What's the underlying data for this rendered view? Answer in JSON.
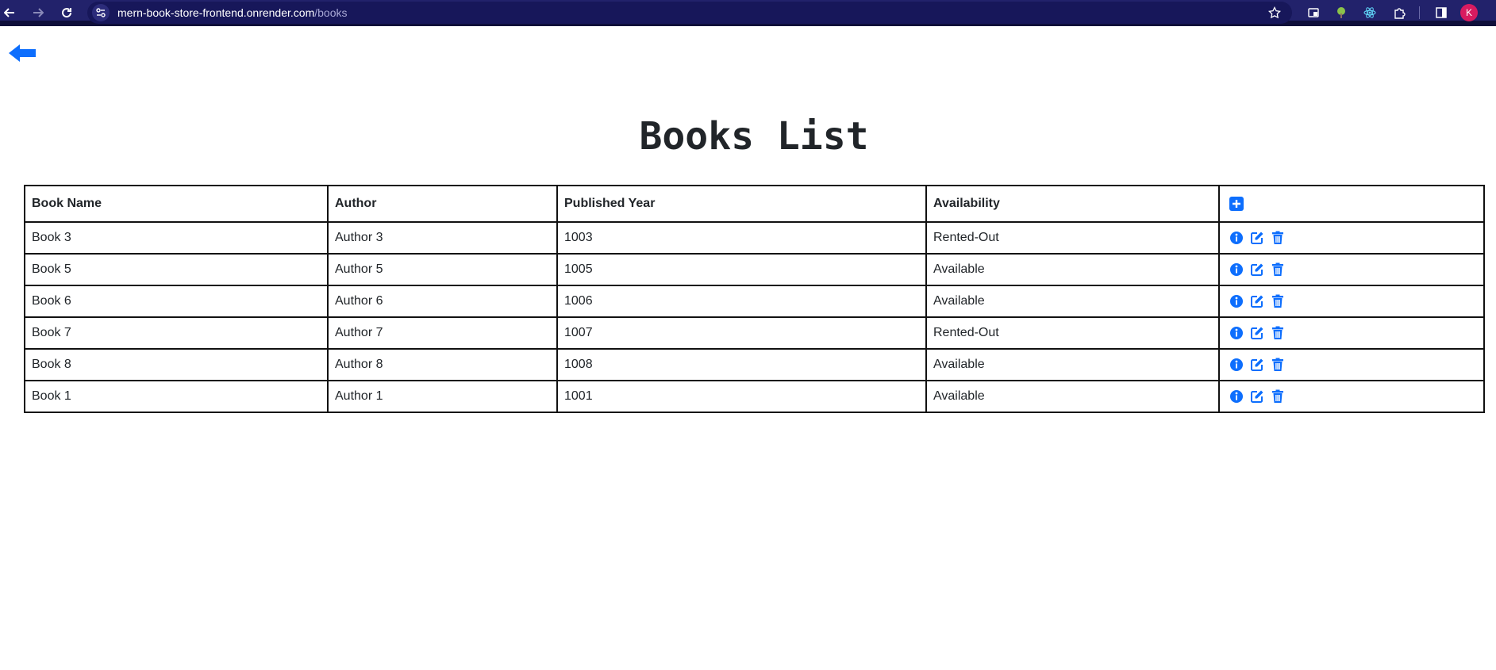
{
  "browser": {
    "url_host": "mern-book-store-frontend.onrender.com",
    "url_path": "/books",
    "profile_initial": "K"
  },
  "page": {
    "title": "Books List"
  },
  "table": {
    "headers": {
      "name": "Book Name",
      "author": "Author",
      "year": "Published Year",
      "availability": "Availability"
    },
    "rows": [
      {
        "name": "Book 3",
        "author": "Author 3",
        "year": "1003",
        "availability": "Rented-Out"
      },
      {
        "name": "Book 5",
        "author": "Author 5",
        "year": "1005",
        "availability": "Available"
      },
      {
        "name": "Book 6",
        "author": "Author 6",
        "year": "1006",
        "availability": "Available"
      },
      {
        "name": "Book 7",
        "author": "Author 7",
        "year": "1007",
        "availability": "Rented-Out"
      },
      {
        "name": "Book 8",
        "author": "Author 8",
        "year": "1008",
        "availability": "Available"
      },
      {
        "name": "Book 1",
        "author": "Author 1",
        "year": "1001",
        "availability": "Available"
      }
    ]
  },
  "icons": {
    "back": "arrow-left-icon",
    "add": "plus-square-icon",
    "info": "info-circle-icon",
    "edit": "edit-icon",
    "delete": "trash-icon"
  },
  "colors": {
    "accent": "#0d6efd",
    "chrome_bg": "#22226b",
    "table_border": "#111111"
  }
}
